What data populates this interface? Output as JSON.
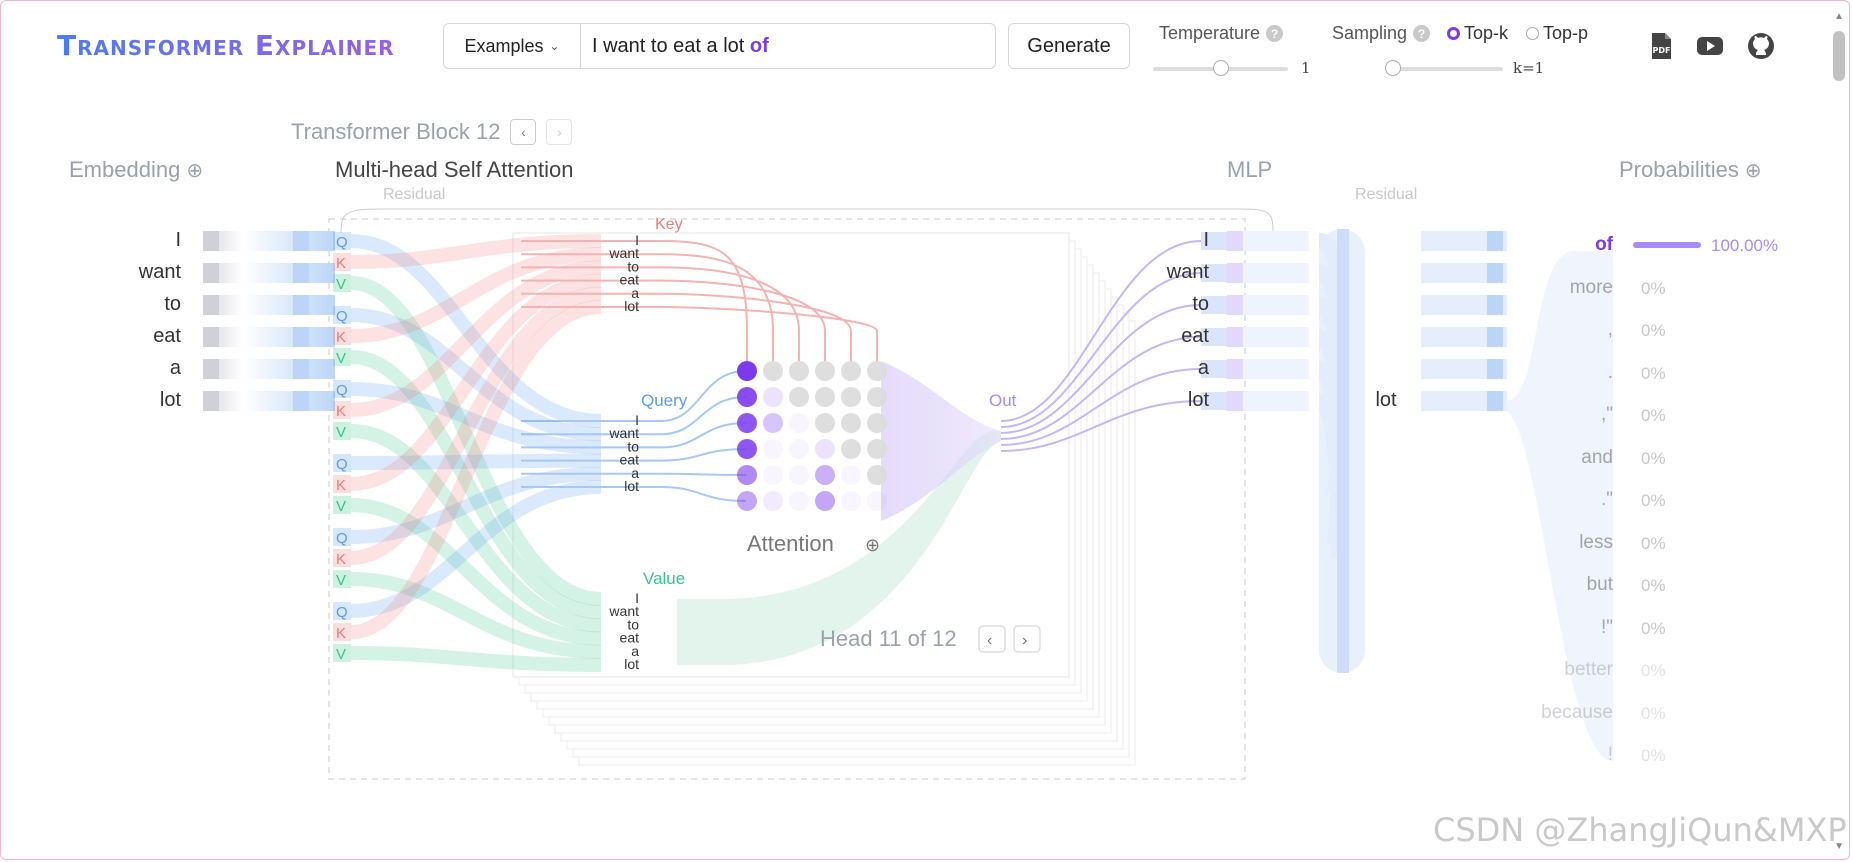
{
  "header": {
    "logo": "Transformer Explainer",
    "examples_label": "Examples",
    "prompt_text": "I want to eat a lot",
    "predicted_token": "of",
    "generate_label": "Generate",
    "temperature_label": "Temperature",
    "temperature_value": "1",
    "temperature_fraction": 0.5,
    "sampling_label": "Sampling",
    "topk_label": "Top-k",
    "topp_label": "Top-p",
    "selected_sampling": "Top-k",
    "k_value": "k=1",
    "k_fraction": 0.0
  },
  "block": {
    "title": "Transformer Block 12",
    "embedding_label": "Embedding",
    "attention_label": "Multi-head Self Attention",
    "mlp_label": "MLP",
    "probabilities_label": "Probabilities",
    "residual_label": "Residual",
    "residual2_label": "Residual",
    "key_label": "Key",
    "query_label": "Query",
    "value_label": "Value",
    "out_label": "Out",
    "attention_matrix_label": "Attention",
    "head_label": "Head 11 of 12",
    "q_letter": "Q",
    "k_letter": "K",
    "v_letter": "V",
    "mlp_focus_token": "lot"
  },
  "tokens": [
    "I",
    "want",
    "to",
    "eat",
    "a",
    "lot"
  ],
  "probabilities": [
    {
      "token": "of",
      "value": "100.00%",
      "fraction": 1.0
    },
    {
      "token": "more",
      "value": "0%",
      "fraction": 0
    },
    {
      "token": ",",
      "value": "0%",
      "fraction": 0
    },
    {
      "token": ".",
      "value": "0%",
      "fraction": 0
    },
    {
      "token": ",\"",
      "value": "0%",
      "fraction": 0
    },
    {
      "token": "and",
      "value": "0%",
      "fraction": 0
    },
    {
      "token": ".\"",
      "value": "0%",
      "fraction": 0
    },
    {
      "token": "less",
      "value": "0%",
      "fraction": 0
    },
    {
      "token": "but",
      "value": "0%",
      "fraction": 0
    },
    {
      "token": "!\"",
      "value": "0%",
      "fraction": 0
    },
    {
      "token": "better",
      "value": "0%",
      "fraction": 0
    },
    {
      "token": "because",
      "value": "0%",
      "fraction": 0
    },
    {
      "token": "!",
      "value": "0%",
      "fraction": 0
    }
  ],
  "attention_weights": [
    [
      1.0,
      0.15,
      0.15,
      0.15,
      0.15,
      0.15
    ],
    [
      0.9,
      0.15,
      0.15,
      0.15,
      0.15,
      0.15
    ],
    [
      0.85,
      0.3,
      0.05,
      0.15,
      0.15,
      0.15
    ],
    [
      0.85,
      0.05,
      0.05,
      0.15,
      0.15,
      0.15
    ],
    [
      0.6,
      0.05,
      0.05,
      0.4,
      0.05,
      0.15
    ],
    [
      0.45,
      0.1,
      0.05,
      0.45,
      0.05,
      0.05
    ]
  ],
  "colors": {
    "accent": "#7c3aed",
    "query": "#5b9bf0",
    "key": "#f07a7a",
    "value": "#3cc287",
    "attention_dot": "#7c3aed",
    "embedding_blue": "#bcd5f7",
    "probability_bar": "#a78bfa"
  },
  "watermark": "CSDN @ZhangJiQun&MXP"
}
